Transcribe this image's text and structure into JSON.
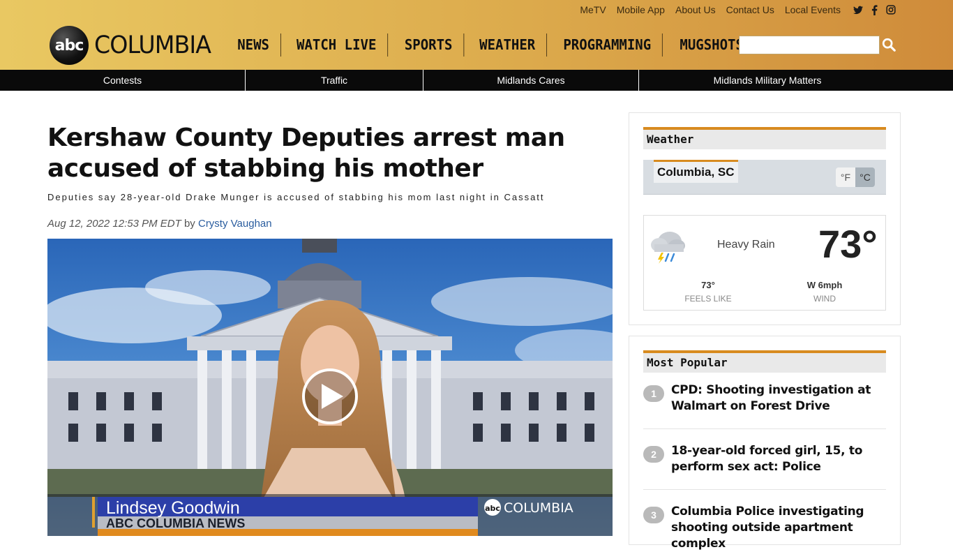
{
  "top_links": [
    "MeTV",
    "Mobile App",
    "About Us",
    "Contact Us",
    "Local Events"
  ],
  "social_icons": [
    "twitter-icon",
    "facebook-icon",
    "instagram-icon"
  ],
  "logo": {
    "badge": "abc",
    "wordmark": "COLUMBIA"
  },
  "main_nav": [
    "NEWS",
    "WATCH LIVE",
    "SPORTS",
    "WEATHER",
    "PROGRAMMING",
    "MUGSHOTS"
  ],
  "search": {
    "placeholder": "",
    "icon": "search-icon"
  },
  "sub_nav": [
    "Contests",
    "Traffic",
    "Midlands Cares",
    "Midlands Military Matters"
  ],
  "article": {
    "headline": "Kershaw County Deputies arrest man accused of stabbing his mother",
    "subhead": "Deputies say 28-year-old Drake Munger is accused of stabbing his mom last night in Cassatt",
    "date": "Aug 12, 2022 12:53 PM EDT",
    "by": "by",
    "author": "Crysty Vaughan"
  },
  "video": {
    "lower_third_name": "Lindsey Goodwin",
    "lower_third_org": "ABC COLUMBIA NEWS",
    "bug_badge": "abc",
    "bug_text": "COLUMBIA",
    "play_icon": "play-icon"
  },
  "weather": {
    "title": "Weather",
    "location": "Columbia, SC",
    "unit_f": "°F",
    "unit_c": "°C",
    "condition": "Heavy Rain",
    "temp": "73°",
    "feels_like_value": "73°",
    "feels_like_label": "FEELS LIKE",
    "wind_value": "W 6mph",
    "wind_label": "WIND",
    "icon": "rain-cloud-icon"
  },
  "most_popular": {
    "title": "Most Popular",
    "items": [
      {
        "rank": "1",
        "title": "CPD: Shooting investigation at Walmart on Forest Drive"
      },
      {
        "rank": "2",
        "title": "18-year-old forced girl, 15, to perform sex act: Police"
      },
      {
        "rank": "3",
        "title": "Columbia Police investigating shooting outside apartment complex"
      }
    ]
  },
  "colors": {
    "accent": "#d88b1f",
    "header_gold": "#dcaa4c",
    "link_blue": "#2a5d9f"
  }
}
